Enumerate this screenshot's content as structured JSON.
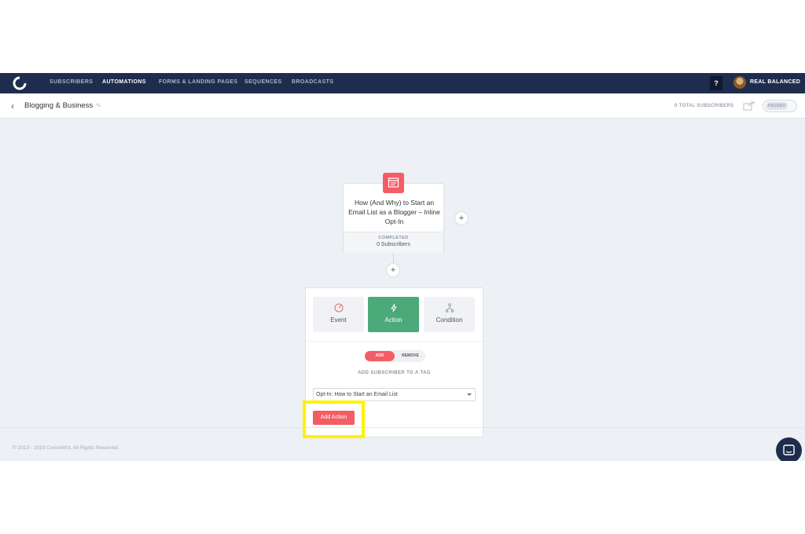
{
  "nav": {
    "items": [
      "SUBSCRIBERS",
      "AUTOMATIONS",
      "FORMS & LANDING PAGES",
      "SEQUENCES",
      "BROADCASTS"
    ],
    "active_index": 1,
    "help_label": "?",
    "user_name": "REAL BALANCED"
  },
  "header": {
    "title": "Blogging & Business",
    "total_subscribers": "0 TOTAL SUBSCRIBERS",
    "status_label": "PAUSED"
  },
  "trigger": {
    "title": "How (And Why) to Start an Email List as a Blogger – Inline Opt-In",
    "status": "COMPLETED",
    "subscribers": "0 Subscribers",
    "icon": "form-icon"
  },
  "panel": {
    "types": [
      {
        "label": "Event",
        "icon": "gauge-icon",
        "active": false
      },
      {
        "label": "Action",
        "icon": "lightning-icon",
        "active": true
      },
      {
        "label": "Condition",
        "icon": "branch-icon",
        "active": false
      }
    ],
    "add_label": "ADD",
    "remove_label": "REMOVE",
    "subheading": "ADD SUBSCRIBER TO A TAG",
    "selected_tag": "Opt-In: How to Start an Email List",
    "add_action_label": "Add Action"
  },
  "footer": {
    "copyright": "© 2013 - 2019 ConvertKit. All Rights Reserved."
  },
  "colors": {
    "nav_bg": "#1e2d4d",
    "accent_red": "#f45d66",
    "action_green": "#4ca97a",
    "highlight": "#fff200"
  }
}
